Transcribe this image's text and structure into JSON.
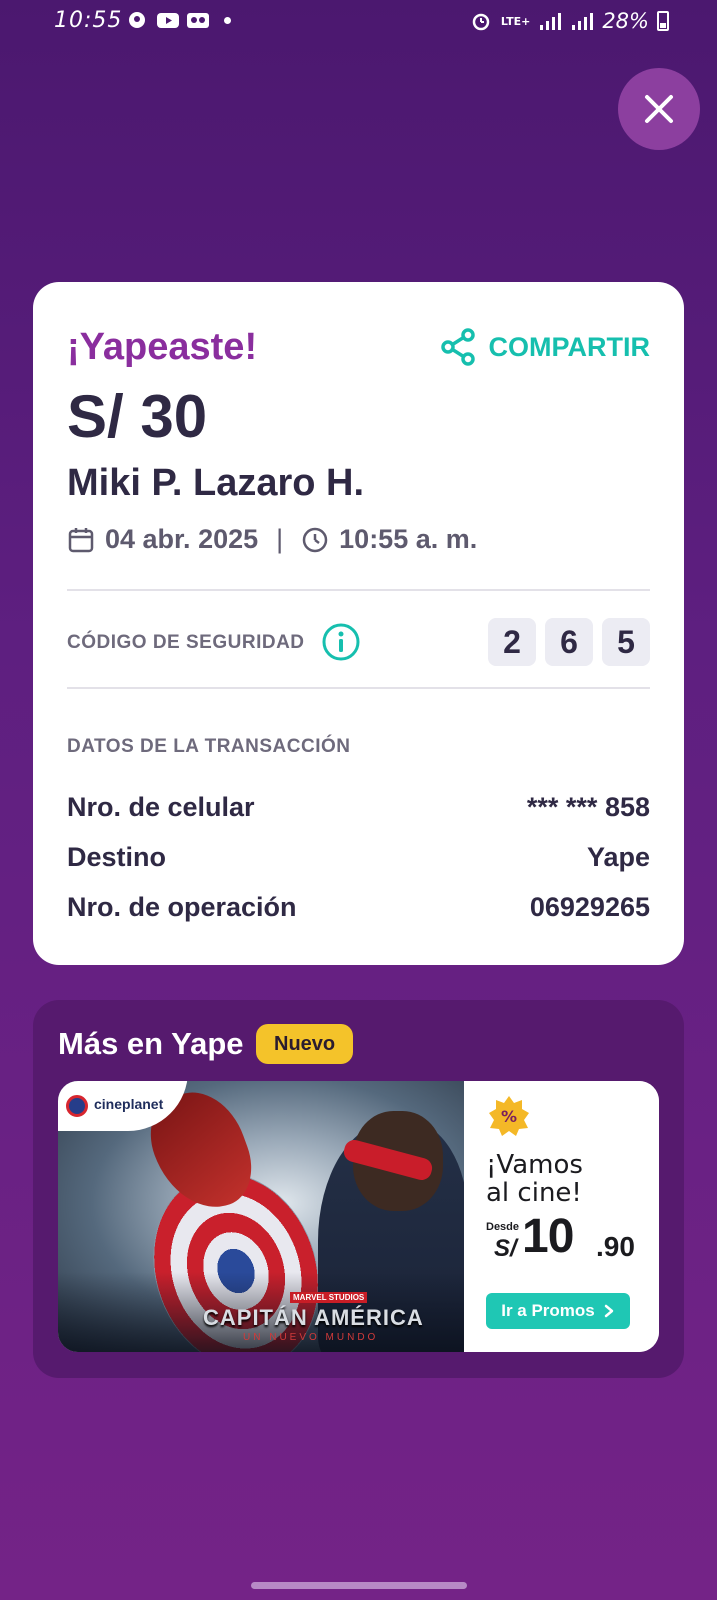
{
  "status_bar": {
    "time": "10:55",
    "network": "LTE+",
    "battery": "28%"
  },
  "card": {
    "title": "¡Yapeaste!",
    "share_label": "COMPARTIR",
    "amount": "S/ 30",
    "recipient": "Miki P. Lazaro H.",
    "date": "04 abr. 2025",
    "separator": "|",
    "time": "10:55 a. m.",
    "security_label": "CÓDIGO DE SEGURIDAD",
    "security_code": [
      "2",
      "6",
      "5"
    ],
    "transaction_title": "DATOS DE LA TRANSACCIÓN",
    "transaction_rows": [
      {
        "label": "Nro. de celular",
        "value": "*** *** 858"
      },
      {
        "label": "Destino",
        "value": "Yape"
      },
      {
        "label": "Nro. de operación",
        "value": "06929265"
      }
    ]
  },
  "promo": {
    "title": "Más en Yape",
    "badge": "Nuevo",
    "banner": {
      "brand": "cineplanet",
      "studio": "MARVEL STUDIOS",
      "movie_title": "CAPITÁN AMÉRICA",
      "movie_subtitle": "UN NUEVO MUNDO",
      "headline_line1": "¡Vamos",
      "headline_line2": "al cine!",
      "price_prefix": "Desde",
      "price_currency": "S/",
      "price_integer": "10",
      "price_decimal": ".90",
      "button_label": "Ir a Promos"
    }
  },
  "colors": {
    "brand_purple": "#8a2e9e",
    "accent_teal": "#16bfae",
    "badge_yellow": "#f4c32a",
    "text_dark": "#2f2944"
  }
}
